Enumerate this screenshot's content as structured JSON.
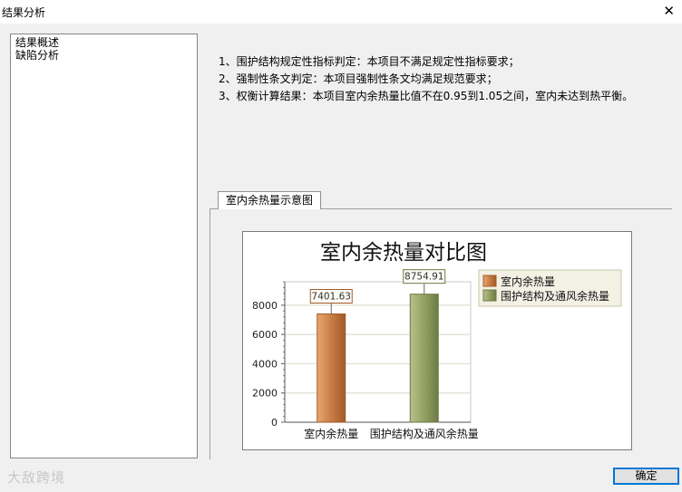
{
  "window": {
    "title": "结果分析",
    "close_glyph": "✕"
  },
  "sidebar": {
    "items": [
      {
        "label": "结果概述"
      },
      {
        "label": "缺陷分析"
      }
    ]
  },
  "results": {
    "lines": [
      "1、围护结构规定性指标判定：本项目不满足规定性指标要求；",
      "2、强制性条文判定：本项目强制性条文均满足规范要求；",
      "3、权衡计算结果：本项目室内余热量比值不在0.95到1.05之间，室内未达到热平衡。"
    ]
  },
  "tab": {
    "label": "室内余热量示意图"
  },
  "chart_data": {
    "type": "bar",
    "title": "室内余热量对比图",
    "categories": [
      "室内余热量",
      "围护结构及通风余热量"
    ],
    "values": [
      7401.63,
      8754.91
    ],
    "value_labels": [
      "7401.63",
      "8754.91"
    ],
    "ylim": [
      0,
      9600
    ],
    "yticks": [
      0,
      2000,
      4000,
      6000,
      8000
    ],
    "ytick_labels": [
      "0",
      "2000",
      "4000",
      "6000",
      "8000"
    ],
    "legend": [
      {
        "label": "室内余热量",
        "color": "#c97c45"
      },
      {
        "label": "围护结构及通风余热量",
        "color": "#93a064"
      }
    ],
    "legend_position": "top-right",
    "grid": true
  },
  "footer": {
    "ok_label": "确定",
    "watermark": "大敌跨境"
  },
  "colors": {
    "accent": "#0078d7",
    "bar1_dark": "#a25a2a",
    "bar1_light": "#e8a770",
    "bar2_dark": "#6d7a44",
    "bar2_light": "#b6c28a"
  }
}
